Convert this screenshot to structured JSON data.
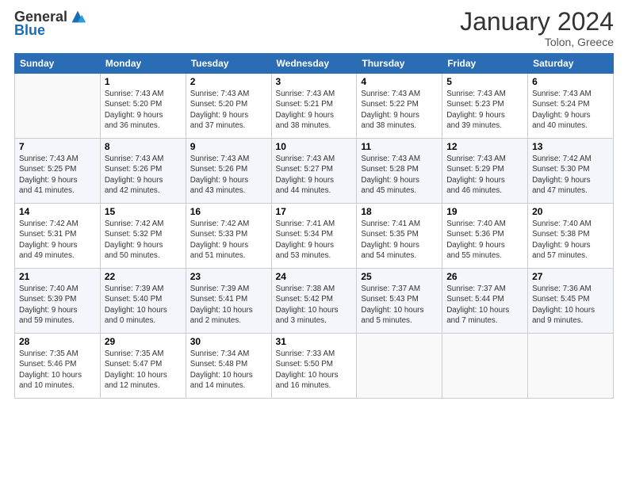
{
  "logo": {
    "text_general": "General",
    "text_blue": "Blue"
  },
  "header": {
    "month_year": "January 2024",
    "location": "Tolon, Greece"
  },
  "days_of_week": [
    "Sunday",
    "Monday",
    "Tuesday",
    "Wednesday",
    "Thursday",
    "Friday",
    "Saturday"
  ],
  "weeks": [
    [
      {
        "day": "",
        "info": ""
      },
      {
        "day": "1",
        "info": "Sunrise: 7:43 AM\nSunset: 5:20 PM\nDaylight: 9 hours\nand 36 minutes."
      },
      {
        "day": "2",
        "info": "Sunrise: 7:43 AM\nSunset: 5:20 PM\nDaylight: 9 hours\nand 37 minutes."
      },
      {
        "day": "3",
        "info": "Sunrise: 7:43 AM\nSunset: 5:21 PM\nDaylight: 9 hours\nand 38 minutes."
      },
      {
        "day": "4",
        "info": "Sunrise: 7:43 AM\nSunset: 5:22 PM\nDaylight: 9 hours\nand 38 minutes."
      },
      {
        "day": "5",
        "info": "Sunrise: 7:43 AM\nSunset: 5:23 PM\nDaylight: 9 hours\nand 39 minutes."
      },
      {
        "day": "6",
        "info": "Sunrise: 7:43 AM\nSunset: 5:24 PM\nDaylight: 9 hours\nand 40 minutes."
      }
    ],
    [
      {
        "day": "7",
        "info": "Sunrise: 7:43 AM\nSunset: 5:25 PM\nDaylight: 9 hours\nand 41 minutes."
      },
      {
        "day": "8",
        "info": "Sunrise: 7:43 AM\nSunset: 5:26 PM\nDaylight: 9 hours\nand 42 minutes."
      },
      {
        "day": "9",
        "info": "Sunrise: 7:43 AM\nSunset: 5:26 PM\nDaylight: 9 hours\nand 43 minutes."
      },
      {
        "day": "10",
        "info": "Sunrise: 7:43 AM\nSunset: 5:27 PM\nDaylight: 9 hours\nand 44 minutes."
      },
      {
        "day": "11",
        "info": "Sunrise: 7:43 AM\nSunset: 5:28 PM\nDaylight: 9 hours\nand 45 minutes."
      },
      {
        "day": "12",
        "info": "Sunrise: 7:43 AM\nSunset: 5:29 PM\nDaylight: 9 hours\nand 46 minutes."
      },
      {
        "day": "13",
        "info": "Sunrise: 7:42 AM\nSunset: 5:30 PM\nDaylight: 9 hours\nand 47 minutes."
      }
    ],
    [
      {
        "day": "14",
        "info": "Sunrise: 7:42 AM\nSunset: 5:31 PM\nDaylight: 9 hours\nand 49 minutes."
      },
      {
        "day": "15",
        "info": "Sunrise: 7:42 AM\nSunset: 5:32 PM\nDaylight: 9 hours\nand 50 minutes."
      },
      {
        "day": "16",
        "info": "Sunrise: 7:42 AM\nSunset: 5:33 PM\nDaylight: 9 hours\nand 51 minutes."
      },
      {
        "day": "17",
        "info": "Sunrise: 7:41 AM\nSunset: 5:34 PM\nDaylight: 9 hours\nand 53 minutes."
      },
      {
        "day": "18",
        "info": "Sunrise: 7:41 AM\nSunset: 5:35 PM\nDaylight: 9 hours\nand 54 minutes."
      },
      {
        "day": "19",
        "info": "Sunrise: 7:40 AM\nSunset: 5:36 PM\nDaylight: 9 hours\nand 55 minutes."
      },
      {
        "day": "20",
        "info": "Sunrise: 7:40 AM\nSunset: 5:38 PM\nDaylight: 9 hours\nand 57 minutes."
      }
    ],
    [
      {
        "day": "21",
        "info": "Sunrise: 7:40 AM\nSunset: 5:39 PM\nDaylight: 9 hours\nand 59 minutes."
      },
      {
        "day": "22",
        "info": "Sunrise: 7:39 AM\nSunset: 5:40 PM\nDaylight: 10 hours\nand 0 minutes."
      },
      {
        "day": "23",
        "info": "Sunrise: 7:39 AM\nSunset: 5:41 PM\nDaylight: 10 hours\nand 2 minutes."
      },
      {
        "day": "24",
        "info": "Sunrise: 7:38 AM\nSunset: 5:42 PM\nDaylight: 10 hours\nand 3 minutes."
      },
      {
        "day": "25",
        "info": "Sunrise: 7:37 AM\nSunset: 5:43 PM\nDaylight: 10 hours\nand 5 minutes."
      },
      {
        "day": "26",
        "info": "Sunrise: 7:37 AM\nSunset: 5:44 PM\nDaylight: 10 hours\nand 7 minutes."
      },
      {
        "day": "27",
        "info": "Sunrise: 7:36 AM\nSunset: 5:45 PM\nDaylight: 10 hours\nand 9 minutes."
      }
    ],
    [
      {
        "day": "28",
        "info": "Sunrise: 7:35 AM\nSunset: 5:46 PM\nDaylight: 10 hours\nand 10 minutes."
      },
      {
        "day": "29",
        "info": "Sunrise: 7:35 AM\nSunset: 5:47 PM\nDaylight: 10 hours\nand 12 minutes."
      },
      {
        "day": "30",
        "info": "Sunrise: 7:34 AM\nSunset: 5:48 PM\nDaylight: 10 hours\nand 14 minutes."
      },
      {
        "day": "31",
        "info": "Sunrise: 7:33 AM\nSunset: 5:50 PM\nDaylight: 10 hours\nand 16 minutes."
      },
      {
        "day": "",
        "info": ""
      },
      {
        "day": "",
        "info": ""
      },
      {
        "day": "",
        "info": ""
      }
    ]
  ]
}
